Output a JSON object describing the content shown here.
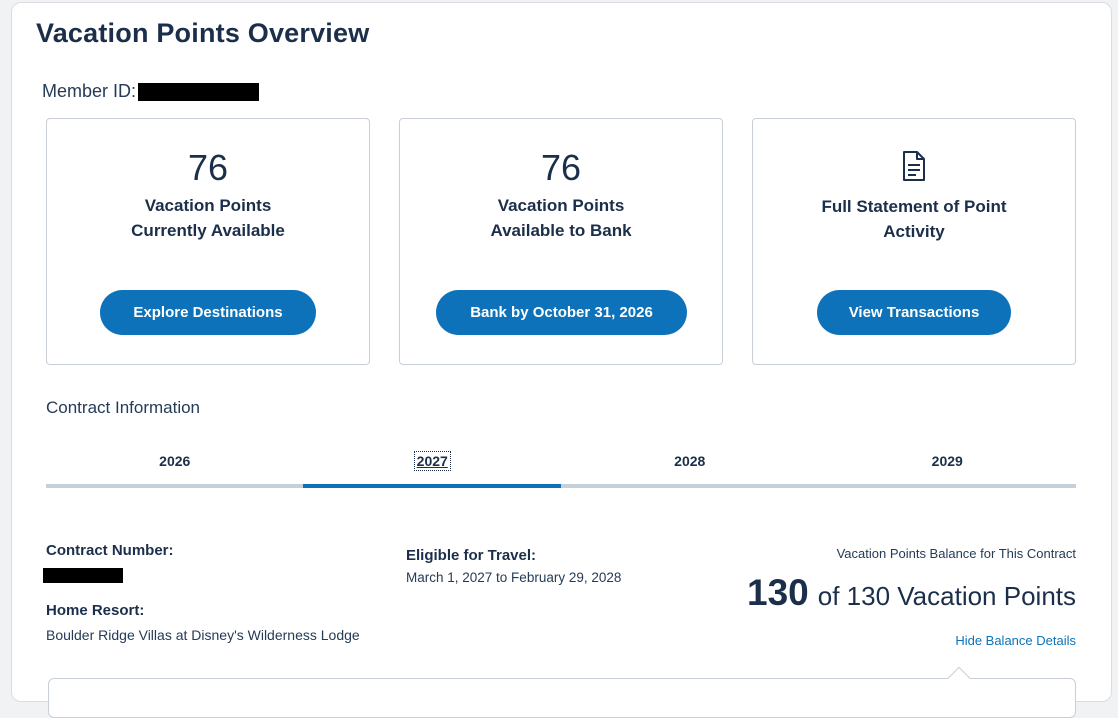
{
  "page": {
    "title": "Vacation Points Overview"
  },
  "member": {
    "label": "Member ID:"
  },
  "cards": [
    {
      "number": "76",
      "label_line1": "Vacation Points",
      "label_line2": "Currently Available",
      "button": "Explore Destinations"
    },
    {
      "number": "76",
      "label_line1": "Vacation Points",
      "label_line2": "Available to Bank",
      "button": "Bank by October 31, 2026"
    },
    {
      "icon": "document-icon",
      "label_line1": "Full Statement of Point",
      "label_line2": "Activity",
      "button": "View Transactions"
    }
  ],
  "contract": {
    "section_title": "Contract Information",
    "tabs": [
      "2026",
      "2027",
      "2028",
      "2029"
    ],
    "active_tab": "2027",
    "number_label": "Contract Number:",
    "home_resort_label": "Home Resort:",
    "home_resort_value": "Boulder Ridge Villas at Disney's Wilderness Lodge",
    "eligible_label": "Eligible for Travel:",
    "eligible_value": "March 1, 2027 to February 29, 2028",
    "balance_caption": "Vacation Points Balance for This Contract",
    "balance_points": "130",
    "balance_rest": "of 130 Vacation Points",
    "hide_link": "Hide Balance Details"
  },
  "colors": {
    "accent": "#0d72b9",
    "text": "#1b2f4a",
    "border": "#c9cfd6"
  }
}
